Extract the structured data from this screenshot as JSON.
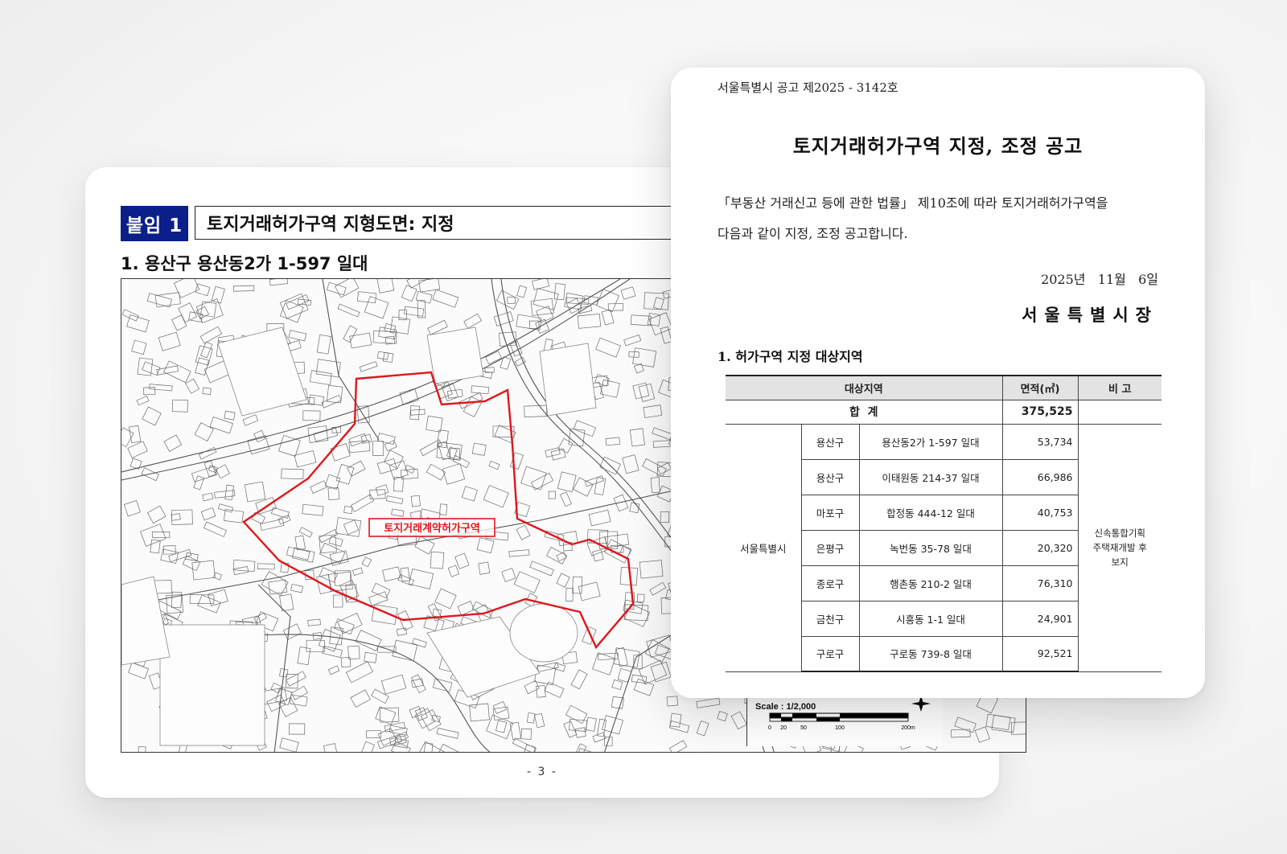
{
  "map_page": {
    "badge": "붙임 1",
    "title": "토지거래허가구역 지형도면: 지정",
    "section": "1. 용산구 용산동2가 1-597 일대",
    "zone_label": "토지거래계약허가구역",
    "scale_label": "Scale : 1/2,000",
    "scale_ticks": [
      "0",
      "20",
      "50",
      "100",
      "200m"
    ],
    "page_number": "- 3 -",
    "colors": {
      "badge": "#0a1f8a",
      "zone_boundary": "#e0161b"
    }
  },
  "notice": {
    "number": "서울특별시 공고 제2025 - 3142호",
    "title": "토지거래허가구역 지정, 조정 공고",
    "body_line1": "「부동산 거래신고 등에 관한 법률」 제10조에 따라 토지거래허가구역을",
    "body_line2": "다음과 같이 지정, 조정 공고합니다.",
    "date": "2025년   11월   6일",
    "issuer": "서울특별시장",
    "subhead": "1. 허가구역 지정 대상지역",
    "table": {
      "headers": {
        "target": "대상지역",
        "area": "면적(㎡)",
        "remark": "비 고"
      },
      "total_label": "합  계",
      "total_value": "375,525",
      "city": "서울특별시",
      "remark": "신속통합기획 주택재개발 후보지",
      "rows": [
        {
          "district": "용산구",
          "location": "용산동2가 1-597 일대",
          "area": "53,734"
        },
        {
          "district": "용산구",
          "location": "이태원동 214-37 일대",
          "area": "66,986"
        },
        {
          "district": "마포구",
          "location": "합정동 444-12 일대",
          "area": "40,753"
        },
        {
          "district": "은평구",
          "location": "녹번동 35-78 일대",
          "area": "20,320"
        },
        {
          "district": "종로구",
          "location": "행촌동 210-2 일대",
          "area": "76,310"
        },
        {
          "district": "금천구",
          "location": "시흥동 1-1 일대",
          "area": "24,901"
        },
        {
          "district": "구로구",
          "location": "구로동 739-8 일대",
          "area": "92,521"
        }
      ]
    }
  }
}
